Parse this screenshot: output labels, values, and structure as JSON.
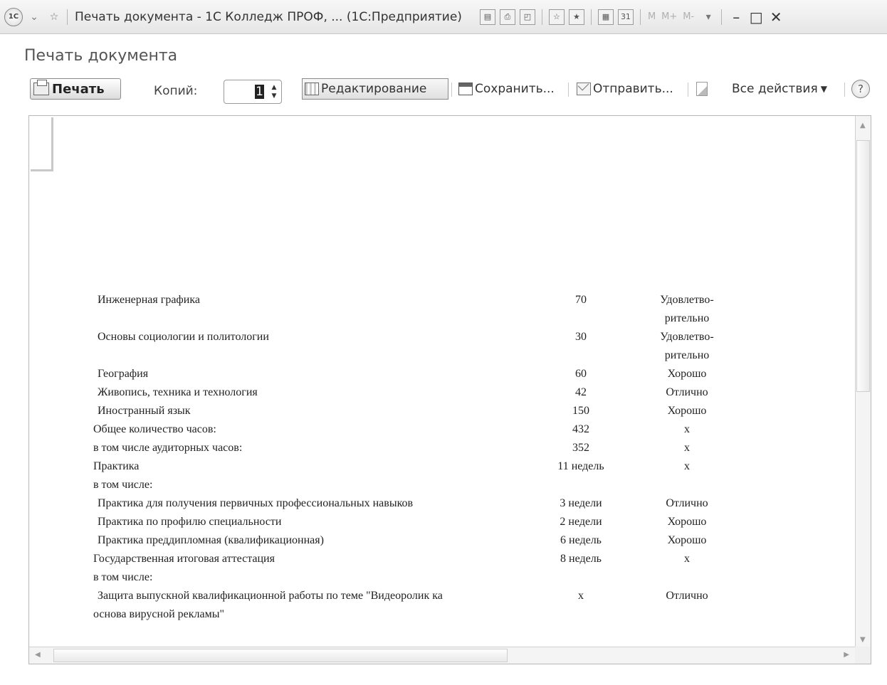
{
  "window": {
    "title": "Печать документа - 1С Колледж ПРОФ, ... (1С:Предприятие)",
    "logo_text": "1С",
    "memory_buttons": [
      "M",
      "M+",
      "M-"
    ]
  },
  "form": {
    "title": "Печать документа"
  },
  "toolbar": {
    "print_label": "Печать",
    "copies_label": "Копий:",
    "copies_value": "1",
    "edit_label": "Редактирование",
    "save_label": "Сохранить...",
    "send_label": "Отправить...",
    "all_actions_label": "Все действия",
    "help_label": "?"
  },
  "report": {
    "rows": [
      {
        "name": "Инженерная графика",
        "hours": "70",
        "grade": "Удовлетво-",
        "grade2": "рительно"
      },
      {
        "name": "Основы социологии и политологии",
        "hours": "30",
        "grade": "Удовлетво-",
        "grade2": "рительно"
      },
      {
        "name": "География",
        "hours": "60",
        "grade": "Хорошо"
      },
      {
        "name": "Живопись, техника и технология",
        "hours": "42",
        "grade": "Отлично"
      },
      {
        "name": "Иностранный язык",
        "hours": "150",
        "grade": "Хорошо"
      },
      {
        "name": "Общее количество часов:",
        "hours": "432",
        "grade": "x"
      },
      {
        "name": "в том числе аудиторных часов:",
        "hours": "352",
        "grade": "x"
      },
      {
        "name": "Практика",
        "hours": "11 недель",
        "grade": "x"
      },
      {
        "name": "в том числе:",
        "hours": "",
        "grade": ""
      },
      {
        "name": "Практика для получения первичных профессиональных навыков",
        "hours": "3 недели",
        "grade": "Отлично"
      },
      {
        "name": "Практика по профилю специальности",
        "hours": "2 недели",
        "grade": "Хорошо"
      },
      {
        "name": "Практика преддипломная (квалификационная)",
        "hours": "6 недель",
        "grade": "Хорошо"
      },
      {
        "name": "Государственная итоговая аттестация",
        "hours": "8 недель",
        "grade": "x"
      },
      {
        "name": "в том числе:",
        "hours": "",
        "grade": ""
      },
      {
        "name": "Защита выпускной квалификационной работы по теме \"Видеоролик ка",
        "hours": "x",
        "grade": "Отлично"
      },
      {
        "name": "основа вирусной рекламы\"",
        "hours": "",
        "grade": ""
      }
    ]
  }
}
